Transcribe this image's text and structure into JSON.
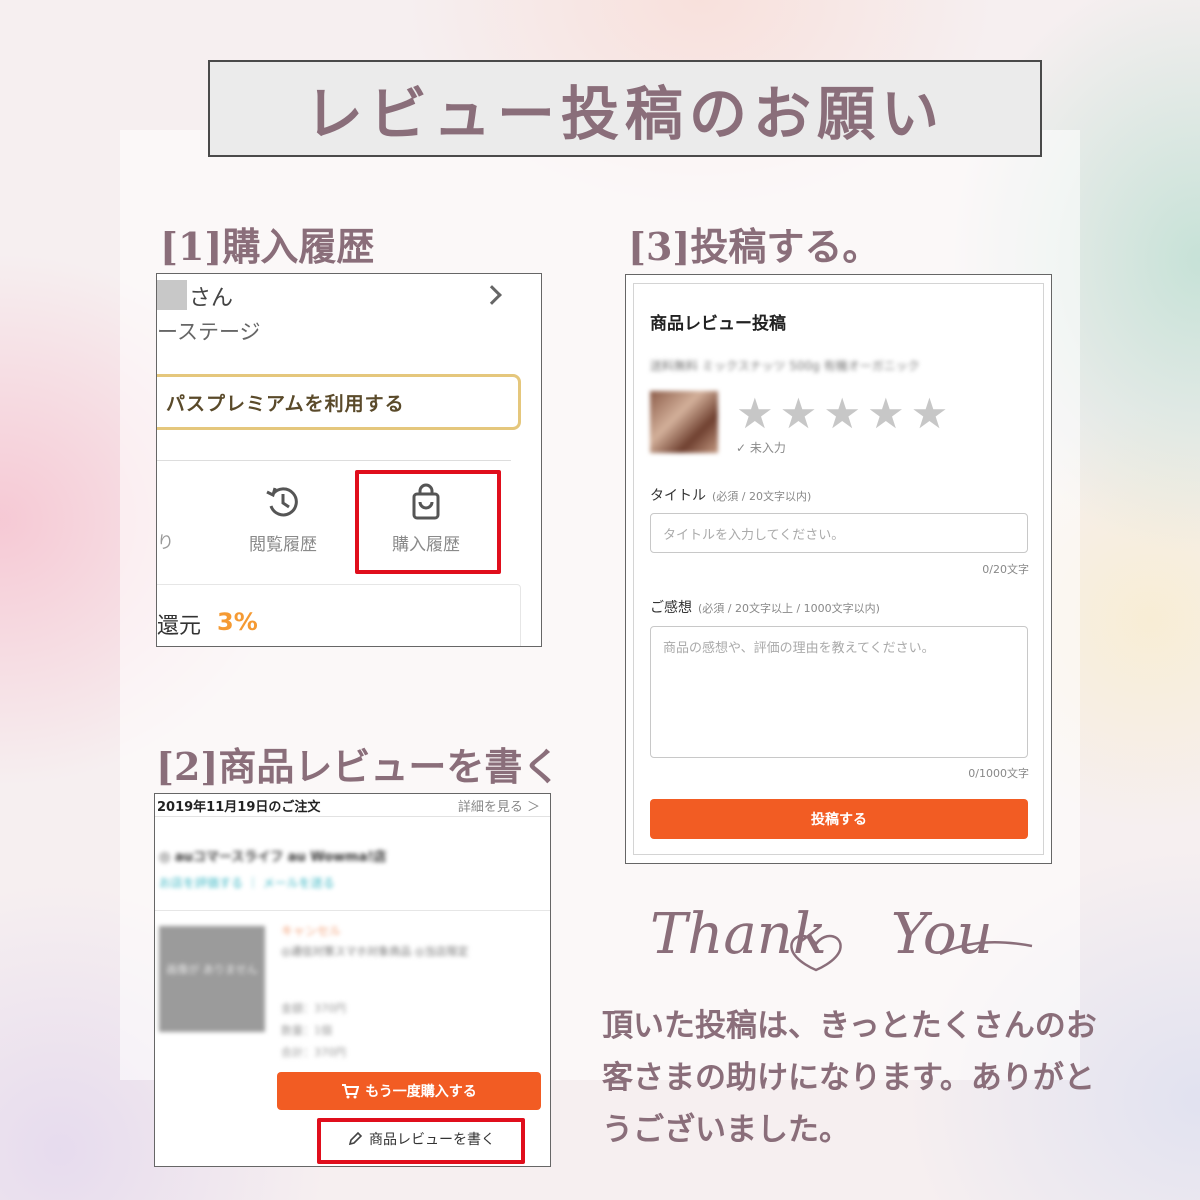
{
  "header": {
    "title": "レビュー投稿のお願い"
  },
  "steps": [
    {
      "title": "[1]購入履歴"
    },
    {
      "title": "[2]商品レビューを書く"
    },
    {
      "title": "[3]投稿する。"
    }
  ],
  "screenshot1": {
    "user_suffix": "さん",
    "stage_text": "ーステージ",
    "premium_text": "パスプレミアムを利用する",
    "partial_item": "り",
    "history_label": "閲覧履歴",
    "purchase_label": "購入履歴",
    "return_label": "還元",
    "return_value": "3%"
  },
  "screenshot2": {
    "order_date": "2019年11月19日のご注文",
    "details_link": "詳細を見る ＞",
    "product_name": "◎ auコマースライフ au Wowma!店",
    "shop_links": "お店を評価する ｜ メールを送る",
    "thumb_text": "画像が\nありません",
    "status": "キャンセル",
    "description": "◎通信対策スマホ対象商品 ◎当店限定",
    "meta_1": "金額：370円",
    "meta_2": "数量：1個",
    "meta_3": "合計：370円",
    "rebuy_button": "もう一度購入する",
    "review_button": "商品レビューを書く"
  },
  "screenshot3": {
    "heading": "商品レビュー投稿",
    "product_blurred": "送料無料 ミックスナッツ 500g 有機オーガニック",
    "stars": "★",
    "unentered": "✓ 未入力",
    "title_label": "タイトル",
    "title_note": "(必須 / 20文字以内)",
    "title_placeholder": "タイトルを入力してください。",
    "title_count": "0/20文字",
    "impression_label": "ご感想",
    "impression_note": "(必須 / 20文字以上 / 1000文字以内)",
    "impression_placeholder": "商品の感想や、評価の理由を教えてください。",
    "impression_count": "0/1000文字",
    "submit_button": "投稿する"
  },
  "thanks": {
    "text": "Thank You"
  },
  "message": {
    "text": "頂いた投稿は、きっとたくさんのお客さまの助けになります。ありがとうございました。"
  },
  "colors": {
    "accent_text": "#8a6e7a",
    "highlight_frame": "#e00e1c",
    "button_orange": "#f25c23",
    "return_orange": "#f59a33"
  }
}
